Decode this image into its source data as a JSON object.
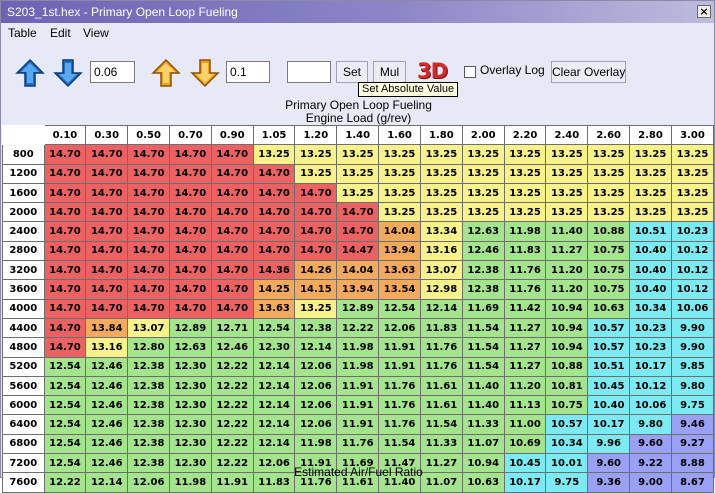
{
  "window": {
    "title": "S203_1st.hex - Primary Open Loop Fueling",
    "close_glyph": "×"
  },
  "menu": [
    "Table",
    "Edit",
    "View"
  ],
  "toolbar": {
    "increment_value": "0.06",
    "multiply_value": "0.1",
    "set_value": "",
    "set_label": "Set",
    "mul_label": "Mul",
    "three_d_label": "3D",
    "overlay_log_label": "Overlay Log",
    "overlay_log_checked": false,
    "clear_overlay_label": "Clear Overlay",
    "tooltip": "Set Absolute Value"
  },
  "table": {
    "title": "Primary Open Loop Fueling",
    "x_axis_label": "Engine Load (g/rev)",
    "footer_label": "Estimated Air/Fuel Ratio",
    "columns": [
      "0.10",
      "0.30",
      "0.50",
      "0.70",
      "0.90",
      "1.05",
      "1.20",
      "1.40",
      "1.60",
      "1.80",
      "2.00",
      "2.20",
      "2.40",
      "2.60",
      "2.80",
      "3.00"
    ],
    "rows": [
      {
        "rpm": "800",
        "values": [
          "14.70",
          "14.70",
          "14.70",
          "14.70",
          "14.70",
          "13.25",
          "13.25",
          "13.25",
          "13.25",
          "13.25",
          "13.25",
          "13.25",
          "13.25",
          "13.25",
          "13.25",
          "13.25"
        ]
      },
      {
        "rpm": "1200",
        "values": [
          "14.70",
          "14.70",
          "14.70",
          "14.70",
          "14.70",
          "14.70",
          "13.25",
          "13.25",
          "13.25",
          "13.25",
          "13.25",
          "13.25",
          "13.25",
          "13.25",
          "13.25",
          "13.25"
        ]
      },
      {
        "rpm": "1600",
        "values": [
          "14.70",
          "14.70",
          "14.70",
          "14.70",
          "14.70",
          "14.70",
          "14.70",
          "13.25",
          "13.25",
          "13.25",
          "13.25",
          "13.25",
          "13.25",
          "13.25",
          "13.25",
          "13.25"
        ]
      },
      {
        "rpm": "2000",
        "values": [
          "14.70",
          "14.70",
          "14.70",
          "14.70",
          "14.70",
          "14.70",
          "14.70",
          "14.70",
          "13.25",
          "13.25",
          "13.25",
          "13.25",
          "13.25",
          "13.25",
          "13.25",
          "13.25"
        ]
      },
      {
        "rpm": "2400",
        "values": [
          "14.70",
          "14.70",
          "14.70",
          "14.70",
          "14.70",
          "14.70",
          "14.70",
          "14.70",
          "14.04",
          "13.34",
          "12.63",
          "11.98",
          "11.40",
          "10.88",
          "10.51",
          "10.23"
        ]
      },
      {
        "rpm": "2800",
        "values": [
          "14.70",
          "14.70",
          "14.70",
          "14.70",
          "14.70",
          "14.70",
          "14.70",
          "14.47",
          "13.94",
          "13.16",
          "12.46",
          "11.83",
          "11.27",
          "10.75",
          "10.40",
          "10.12"
        ]
      },
      {
        "rpm": "3200",
        "values": [
          "14.70",
          "14.70",
          "14.70",
          "14.70",
          "14.70",
          "14.36",
          "14.26",
          "14.04",
          "13.63",
          "13.07",
          "12.38",
          "11.76",
          "11.20",
          "10.75",
          "10.40",
          "10.12"
        ]
      },
      {
        "rpm": "3600",
        "values": [
          "14.70",
          "14.70",
          "14.70",
          "14.70",
          "14.70",
          "14.25",
          "14.15",
          "13.94",
          "13.54",
          "12.98",
          "12.38",
          "11.76",
          "11.20",
          "10.75",
          "10.40",
          "10.12"
        ]
      },
      {
        "rpm": "4000",
        "values": [
          "14.70",
          "14.70",
          "14.70",
          "14.70",
          "14.70",
          "13.63",
          "13.25",
          "12.89",
          "12.54",
          "12.14",
          "11.69",
          "11.42",
          "10.94",
          "10.63",
          "10.34",
          "10.06"
        ]
      },
      {
        "rpm": "4400",
        "values": [
          "14.70",
          "13.84",
          "13.07",
          "12.89",
          "12.71",
          "12.54",
          "12.38",
          "12.22",
          "12.06",
          "11.83",
          "11.54",
          "11.27",
          "10.94",
          "10.57",
          "10.23",
          "9.90"
        ]
      },
      {
        "rpm": "4800",
        "values": [
          "14.70",
          "13.16",
          "12.80",
          "12.63",
          "12.46",
          "12.30",
          "12.14",
          "11.98",
          "11.91",
          "11.76",
          "11.54",
          "11.27",
          "10.94",
          "10.57",
          "10.23",
          "9.90"
        ]
      },
      {
        "rpm": "5200",
        "values": [
          "12.54",
          "12.46",
          "12.38",
          "12.30",
          "12.22",
          "12.14",
          "12.06",
          "11.98",
          "11.91",
          "11.76",
          "11.54",
          "11.27",
          "10.88",
          "10.51",
          "10.17",
          "9.85"
        ]
      },
      {
        "rpm": "5600",
        "values": [
          "12.54",
          "12.46",
          "12.38",
          "12.30",
          "12.22",
          "12.14",
          "12.06",
          "11.91",
          "11.76",
          "11.61",
          "11.40",
          "11.20",
          "10.81",
          "10.45",
          "10.12",
          "9.80"
        ]
      },
      {
        "rpm": "6000",
        "values": [
          "12.54",
          "12.46",
          "12.38",
          "12.30",
          "12.22",
          "12.14",
          "12.06",
          "11.91",
          "11.76",
          "11.61",
          "11.40",
          "11.13",
          "10.75",
          "10.40",
          "10.06",
          "9.75"
        ]
      },
      {
        "rpm": "6400",
        "values": [
          "12.54",
          "12.46",
          "12.38",
          "12.30",
          "12.22",
          "12.14",
          "12.06",
          "11.91",
          "11.76",
          "11.54",
          "11.33",
          "11.00",
          "10.57",
          "10.17",
          "9.80",
          "9.46"
        ]
      },
      {
        "rpm": "6800",
        "values": [
          "12.54",
          "12.46",
          "12.38",
          "12.30",
          "12.22",
          "12.14",
          "11.98",
          "11.76",
          "11.54",
          "11.33",
          "11.07",
          "10.69",
          "10.34",
          "9.96",
          "9.60",
          "9.27"
        ]
      },
      {
        "rpm": "7200",
        "values": [
          "12.54",
          "12.46",
          "12.38",
          "12.30",
          "12.22",
          "12.06",
          "11.91",
          "11.69",
          "11.47",
          "11.27",
          "10.94",
          "10.45",
          "10.01",
          "9.60",
          "9.22",
          "8.88"
        ]
      },
      {
        "rpm": "7600",
        "values": [
          "12.22",
          "12.14",
          "12.06",
          "11.98",
          "11.91",
          "11.83",
          "11.76",
          "11.61",
          "11.40",
          "11.07",
          "10.63",
          "10.17",
          "9.75",
          "9.36",
          "9.00",
          "8.67"
        ]
      }
    ]
  },
  "colors": {
    "cell_red": "#ec6262",
    "cell_orange": "#f4aa5c",
    "cell_yellow": "#f7f38a",
    "cell_green": "#a4e48c",
    "cell_cyan": "#7ceaf2",
    "cell_blue": "#9aa0f4"
  }
}
